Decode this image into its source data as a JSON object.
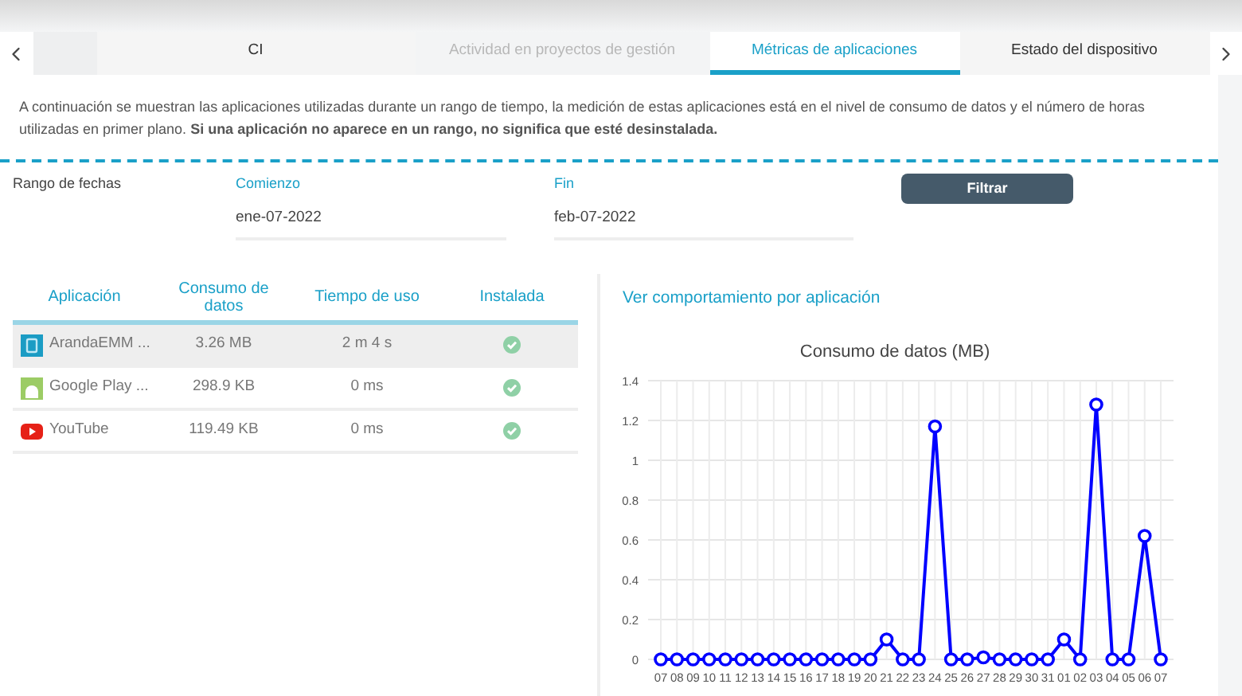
{
  "tabs": [
    {
      "label": "CI",
      "selected": false,
      "disabled": false
    },
    {
      "label": "Actividad en proyectos de gestión",
      "selected": false,
      "disabled": true
    },
    {
      "label": "Métricas de aplicaciones",
      "selected": true,
      "disabled": false
    },
    {
      "label": "Estado del dispositivo",
      "selected": false,
      "disabled": false
    }
  ],
  "description": "A continuación se muestran las aplicaciones utilizadas durante un rango de tiempo, la medición de estas aplicaciones está en el nivel de consumo de datos y el número de horas utilizadas en primer plano. **Si una aplicación no aparece en un rango, no significa que esté desinstalada.**",
  "date_range": {
    "label": "Rango de fechas",
    "start": {
      "label": "Comienzo",
      "value": "ene-07-2022"
    },
    "end": {
      "label": "Fin",
      "value": "feb-07-2022"
    },
    "button": "Filtrar"
  },
  "table": {
    "columns": [
      "Aplicación",
      "Consumo de datos",
      "Tiempo de uso",
      "Instalada"
    ],
    "rows": [
      {
        "app": "ArandaEMM ...",
        "kind": "aranda",
        "data": "3.26 MB",
        "time": "2 m 4 s",
        "installed": true,
        "selected": true
      },
      {
        "app": "Google Play ...",
        "kind": "android",
        "data": "298.9 KB",
        "time": "0 ms",
        "installed": true,
        "selected": false
      },
      {
        "app": "YouTube",
        "kind": "youtube",
        "data": "119.49 KB",
        "time": "0 ms",
        "installed": true,
        "selected": false
      }
    ]
  },
  "chart_link": "Ver comportamiento por aplicación",
  "chart_data": {
    "type": "line",
    "title": "Consumo de datos (MB)",
    "categories": [
      "07",
      "08",
      "09",
      "10",
      "11",
      "12",
      "13",
      "14",
      "15",
      "16",
      "17",
      "18",
      "19",
      "20",
      "21",
      "22",
      "23",
      "24",
      "25",
      "26",
      "27",
      "28",
      "29",
      "30",
      "31",
      "01",
      "02",
      "03",
      "04",
      "05",
      "06",
      "07"
    ],
    "grid": true,
    "series": [
      {
        "color": "#0000ff",
        "marker": "circle",
        "values": [
          0,
          0,
          0,
          0,
          0,
          0,
          0,
          0,
          0,
          0,
          0,
          0,
          0,
          0,
          0.1,
          0,
          0,
          1.17,
          0,
          0,
          0.01,
          0,
          0,
          0,
          0,
          0.1,
          0,
          1.28,
          0,
          0,
          0.62,
          0
        ]
      }
    ],
    "ylim": [
      0,
      1.4
    ],
    "yticks": [
      0,
      0.2,
      0.4,
      0.6,
      0.8,
      {
        "value": 1,
        "label": "1"
      },
      1.2,
      1.4
    ]
  }
}
